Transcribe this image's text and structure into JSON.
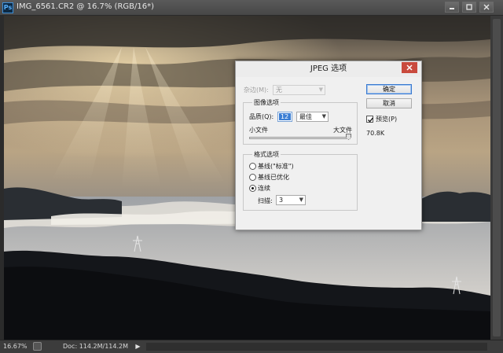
{
  "window": {
    "app_icon": "Ps",
    "document_title": "IMG_6561.CR2 @ 16.7% (RGB/16*)",
    "controls": [
      "minimize-icon",
      "maximize-icon",
      "close-icon"
    ]
  },
  "status_bar": {
    "zoom": "16.67%",
    "doc_info": "Doc: 114.2M/114.2M",
    "arrow": "▶"
  },
  "dialog": {
    "title": "JPEG 选项",
    "matte": {
      "label": "杂边(M):",
      "value": "无"
    },
    "image_options": {
      "legend": "图像选项",
      "quality_label": "品质(Q):",
      "quality_value": "12",
      "quality_preset": "最佳",
      "small_file": "小文件",
      "large_file": "大文件",
      "slider_fraction": 1.0
    },
    "format_options": {
      "legend": "格式选项",
      "baseline_standard": "基线(\"标准\")",
      "baseline_optimized": "基线已优化",
      "progressive": "连续",
      "selected": "progressive",
      "scans_label": "扫描:",
      "scans_value": "3"
    },
    "ok_button": "确定",
    "cancel_button": "取消",
    "preview_label": "预览(P)",
    "preview_checked": true,
    "file_size": "70.8K"
  },
  "colors": {
    "dialog_bg": "#f0f0f0",
    "close_red": "#c94a3d",
    "selection_blue": "#3c7fd4"
  }
}
